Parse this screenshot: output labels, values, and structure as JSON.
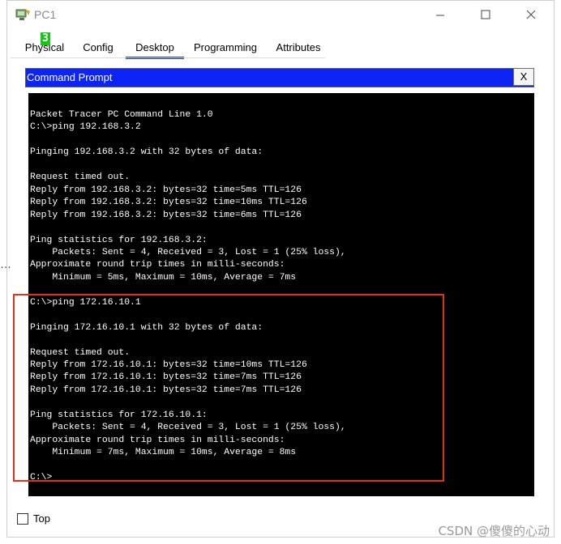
{
  "window": {
    "title": "PC1",
    "icon": "packet-tracer-pc-icon",
    "controls": [
      "minimize-icon",
      "maximize-icon",
      "close-icon"
    ]
  },
  "tabs": {
    "badge": "3",
    "items": [
      {
        "label": "Physical"
      },
      {
        "label": "Config"
      },
      {
        "label": "Desktop",
        "active": true
      },
      {
        "label": "Programming"
      },
      {
        "label": "Attributes"
      }
    ]
  },
  "command_prompt": {
    "title": "Command Prompt",
    "close_label": "X",
    "header_color": "#0d24f6",
    "lines": [
      "Packet Tracer PC Command Line 1.0",
      "C:\\>ping 192.168.3.2",
      "",
      "Pinging 192.168.3.2 with 32 bytes of data:",
      "",
      "Request timed out.",
      "Reply from 192.168.3.2: bytes=32 time=5ms TTL=126",
      "Reply from 192.168.3.2: bytes=32 time=10ms TTL=126",
      "Reply from 192.168.3.2: bytes=32 time=6ms TTL=126",
      "",
      "Ping statistics for 192.168.3.2:",
      "    Packets: Sent = 4, Received = 3, Lost = 1 (25% loss),",
      "Approximate round trip times in milli-seconds:",
      "    Minimum = 5ms, Maximum = 10ms, Average = 7ms",
      "",
      "C:\\>ping 172.16.10.1",
      "",
      "Pinging 172.16.10.1 with 32 bytes of data:",
      "",
      "Request timed out.",
      "Reply from 172.16.10.1: bytes=32 time=10ms TTL=126",
      "Reply from 172.16.10.1: bytes=32 time=7ms TTL=126",
      "Reply from 172.16.10.1: bytes=32 time=7ms TTL=126",
      "",
      "Ping statistics for 172.16.10.1:",
      "    Packets: Sent = 4, Received = 3, Lost = 1 (25% loss),",
      "Approximate round trip times in milli-seconds:",
      "    Minimum = 7ms, Maximum = 10ms, Average = 8ms",
      "",
      "C:\\>"
    ]
  },
  "highlight_color": "#e0301e",
  "footer": {
    "top_label": "Top",
    "top_checked": false
  },
  "side_marker": "…",
  "watermark": "CSDN @傻傻的心动"
}
